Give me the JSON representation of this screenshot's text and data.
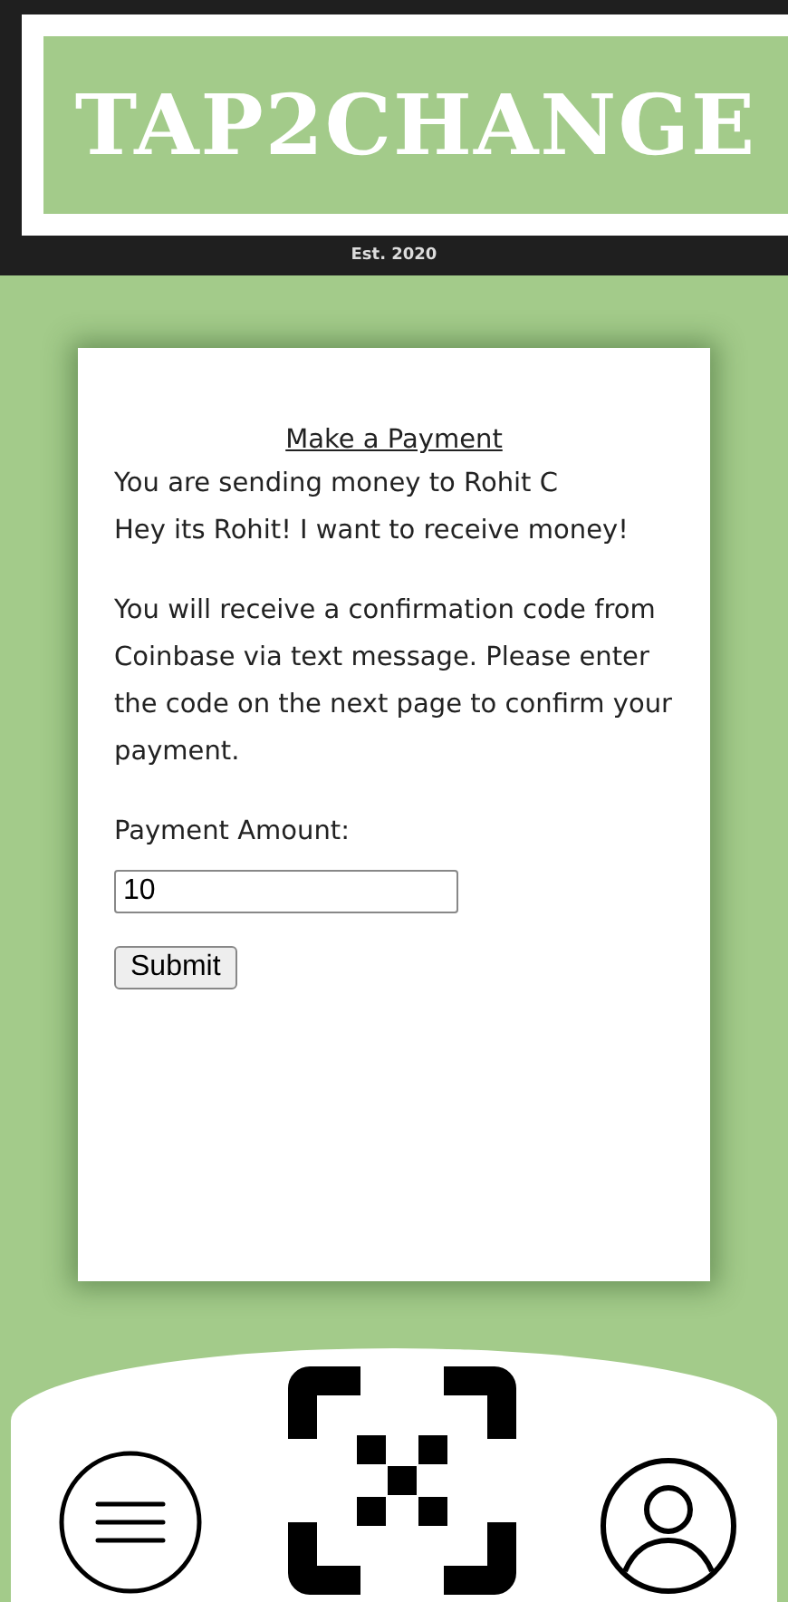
{
  "header": {
    "logo": "TAP2CHANGE",
    "tagline": "Est. 2020"
  },
  "card": {
    "title": "Make a Payment",
    "lines": [
      "You are sending money to Rohit C",
      "Hey its Rohit! I want to receive money!"
    ],
    "notice": "You will receive a confirmation code from Coinbase via text message. Please enter the code on the next page to confirm your payment.",
    "amount_label": "Payment Amount:",
    "amount_value": "10",
    "submit": "Submit"
  }
}
